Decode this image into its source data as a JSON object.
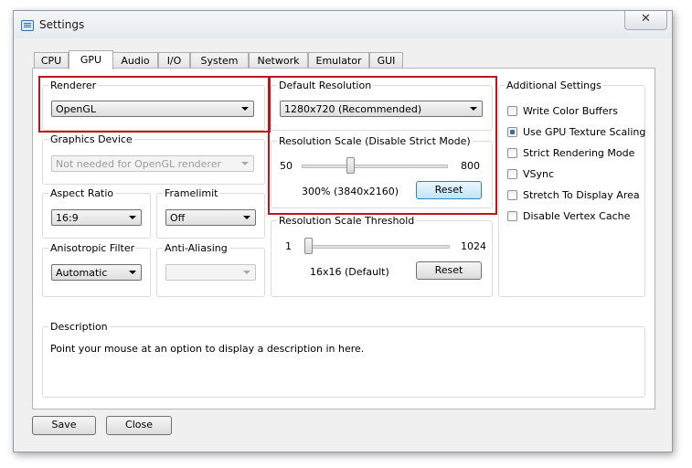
{
  "window": {
    "title": "Settings",
    "close_glyph": "✕"
  },
  "tabs": [
    "CPU",
    "GPU",
    "Audio",
    "I/O",
    "System",
    "Network",
    "Emulator",
    "GUI"
  ],
  "active_tab": "GPU",
  "renderer": {
    "label": "Renderer",
    "value": "OpenGL"
  },
  "graphics_device": {
    "label": "Graphics Device",
    "value": "Not needed for OpenGL renderer"
  },
  "aspect_ratio": {
    "label": "Aspect Ratio",
    "value": "16:9"
  },
  "framelimit": {
    "label": "Framelimit",
    "value": "Off"
  },
  "anisotropic_filter": {
    "label": "Anisotropic Filter",
    "value": "Automatic"
  },
  "anti_aliasing": {
    "label": "Anti-Aliasing",
    "value": ""
  },
  "default_resolution": {
    "label": "Default Resolution",
    "value": "1280x720 (Recommended)"
  },
  "resolution_scale": {
    "label": "Resolution Scale (Disable Strict Mode)",
    "min": "50",
    "max": "800",
    "value_text": "300% (3840x2160)",
    "reset_label": "Reset",
    "slider_fraction": 0.33
  },
  "resolution_threshold": {
    "label": "Resolution Scale Threshold",
    "min": "1",
    "max": "1024",
    "value_text": "16x16 (Default)",
    "reset_label": "Reset",
    "slider_fraction": 0.0
  },
  "additional_settings": {
    "label": "Additional Settings",
    "items": [
      {
        "label": "Write Color Buffers",
        "checked": false
      },
      {
        "label": "Use GPU Texture Scaling",
        "checked": true
      },
      {
        "label": "Strict Rendering Mode",
        "checked": false
      },
      {
        "label": "VSync",
        "checked": false
      },
      {
        "label": "Stretch To Display Area",
        "checked": false
      },
      {
        "label": "Disable Vertex Cache",
        "checked": false
      }
    ]
  },
  "description": {
    "label": "Description",
    "text": "Point your mouse at an option to display a description in here."
  },
  "footer": {
    "save_label": "Save",
    "close_label": "Close"
  },
  "colors": {
    "highlight": "#c0141c",
    "accent": "#3c7fb1"
  }
}
